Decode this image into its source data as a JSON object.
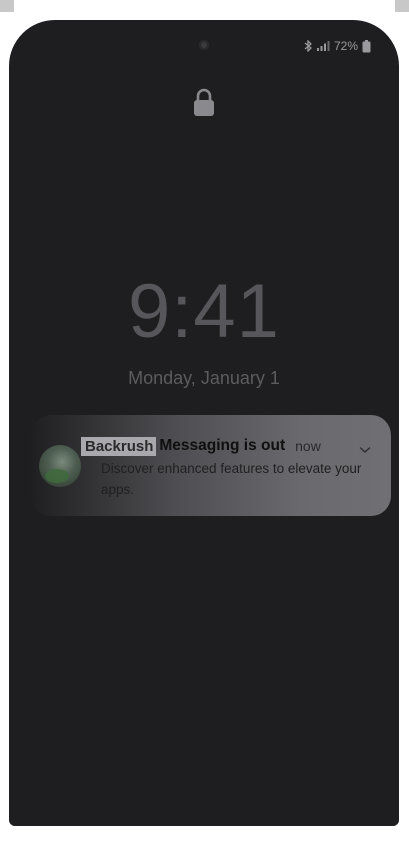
{
  "status_bar": {
    "battery_percent": "72%",
    "icons": [
      "camera-icon",
      "bluetooth-icon",
      "signal-icon",
      "battery-icon"
    ]
  },
  "lock_screen": {
    "lock_icon": "lock-icon",
    "time": "9:41",
    "date": "Monday, January 1"
  },
  "notification": {
    "app_name": "Backrush",
    "title": "Messaging is out",
    "time": "now",
    "body": "Discover enhanced features to elevate your apps.",
    "expand_icon": "chevron-down-icon"
  },
  "colors": {
    "screen_background": "#1e1e20",
    "clock_text": "#57575b",
    "notification_title": "#0f0f10"
  }
}
